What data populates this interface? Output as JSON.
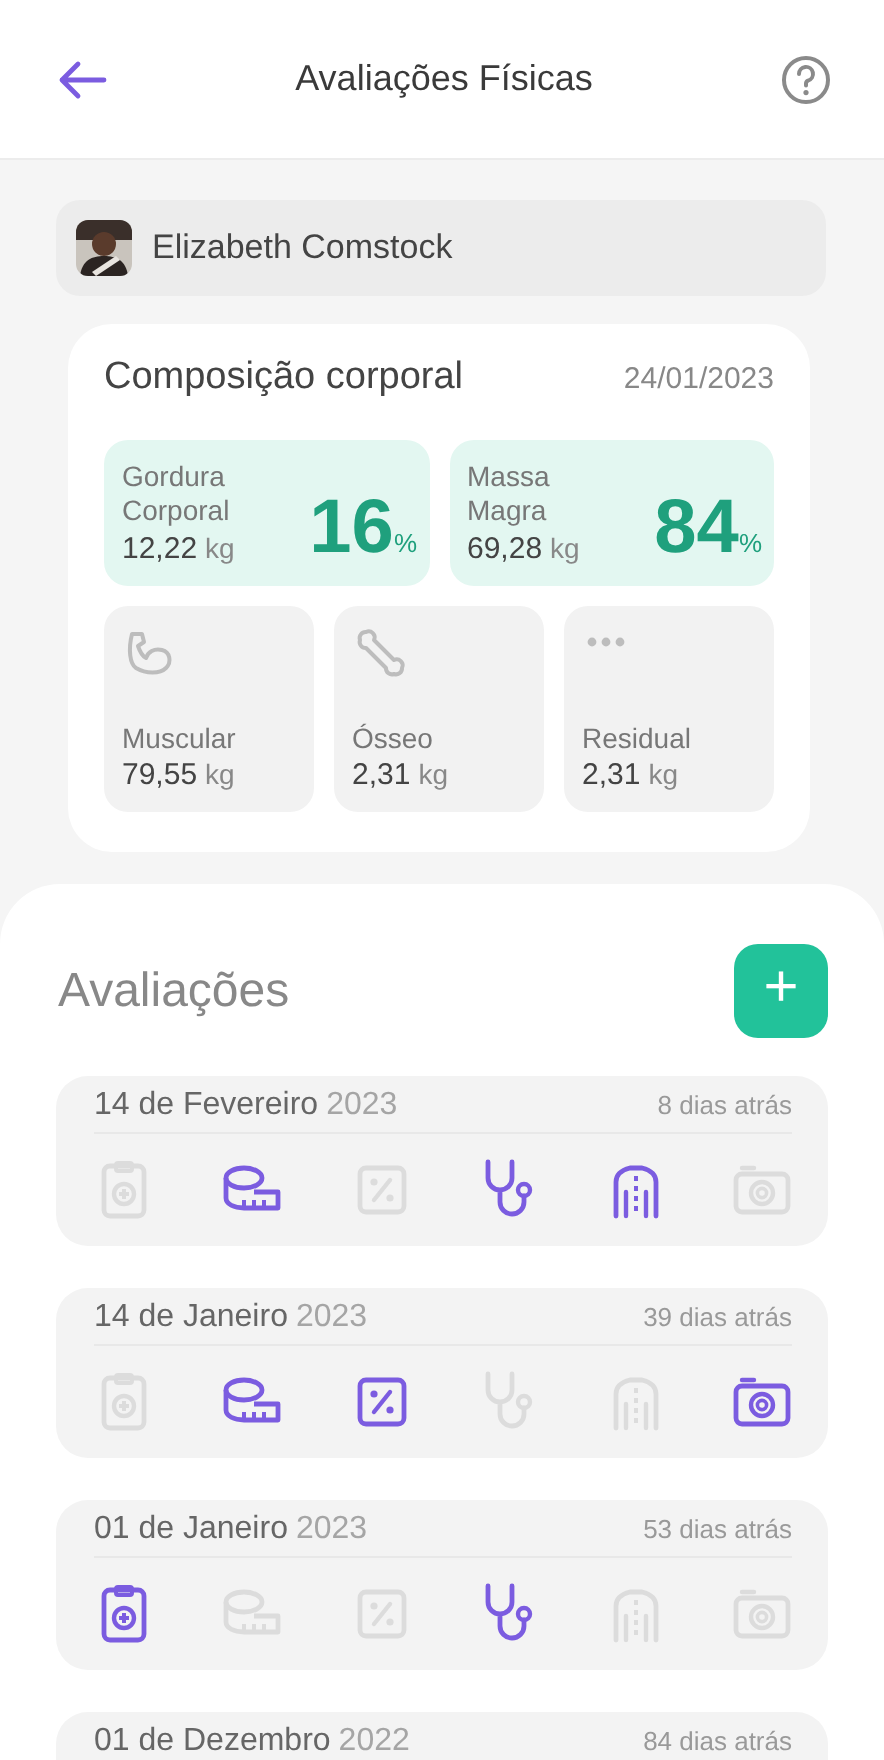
{
  "header": {
    "title": "Avaliações Físicas"
  },
  "patient": {
    "name": "Elizabeth Comstock"
  },
  "composition": {
    "title": "Composição corporal",
    "date": "24/01/2023",
    "main": [
      {
        "label": "Gordura Corporal",
        "value": "12,22",
        "unit": "kg",
        "percent": "16",
        "percent_sign": "%"
      },
      {
        "label": "Massa Magra",
        "value": "69,28",
        "unit": "kg",
        "percent": "84",
        "percent_sign": "%"
      }
    ],
    "parts": [
      {
        "kind": "muscle",
        "label": "Muscular",
        "value": "79,55",
        "unit": "kg"
      },
      {
        "kind": "bone",
        "label": "Ósseo",
        "value": "2,31",
        "unit": "kg"
      },
      {
        "kind": "dots",
        "label": "Residual",
        "value": "2,31",
        "unit": "kg"
      }
    ]
  },
  "evaluations_title": "Avaliações",
  "add_button": "+",
  "evaluations": [
    {
      "date": "14 de Fevereiro",
      "year": "2023",
      "ago": "8 dias atrás",
      "icons": [
        {
          "kind": "clipboard",
          "on": false
        },
        {
          "kind": "tape",
          "on": true
        },
        {
          "kind": "percent",
          "on": false
        },
        {
          "kind": "stethoscope",
          "on": true
        },
        {
          "kind": "posture",
          "on": true
        },
        {
          "kind": "camera",
          "on": false
        }
      ]
    },
    {
      "date": "14 de Janeiro",
      "year": "2023",
      "ago": "39 dias atrás",
      "icons": [
        {
          "kind": "clipboard",
          "on": false
        },
        {
          "kind": "tape",
          "on": true
        },
        {
          "kind": "percent",
          "on": true
        },
        {
          "kind": "stethoscope",
          "on": false
        },
        {
          "kind": "posture",
          "on": false
        },
        {
          "kind": "camera",
          "on": true
        }
      ]
    },
    {
      "date": "01 de Janeiro",
      "year": "2023",
      "ago": "53 dias atrás",
      "icons": [
        {
          "kind": "clipboard",
          "on": true
        },
        {
          "kind": "tape",
          "on": false
        },
        {
          "kind": "percent",
          "on": false
        },
        {
          "kind": "stethoscope",
          "on": true
        },
        {
          "kind": "posture",
          "on": false
        },
        {
          "kind": "camera",
          "on": false
        }
      ]
    },
    {
      "date": "01 de Dezembro",
      "year": "2022",
      "ago": "84 dias atrás"
    }
  ]
}
